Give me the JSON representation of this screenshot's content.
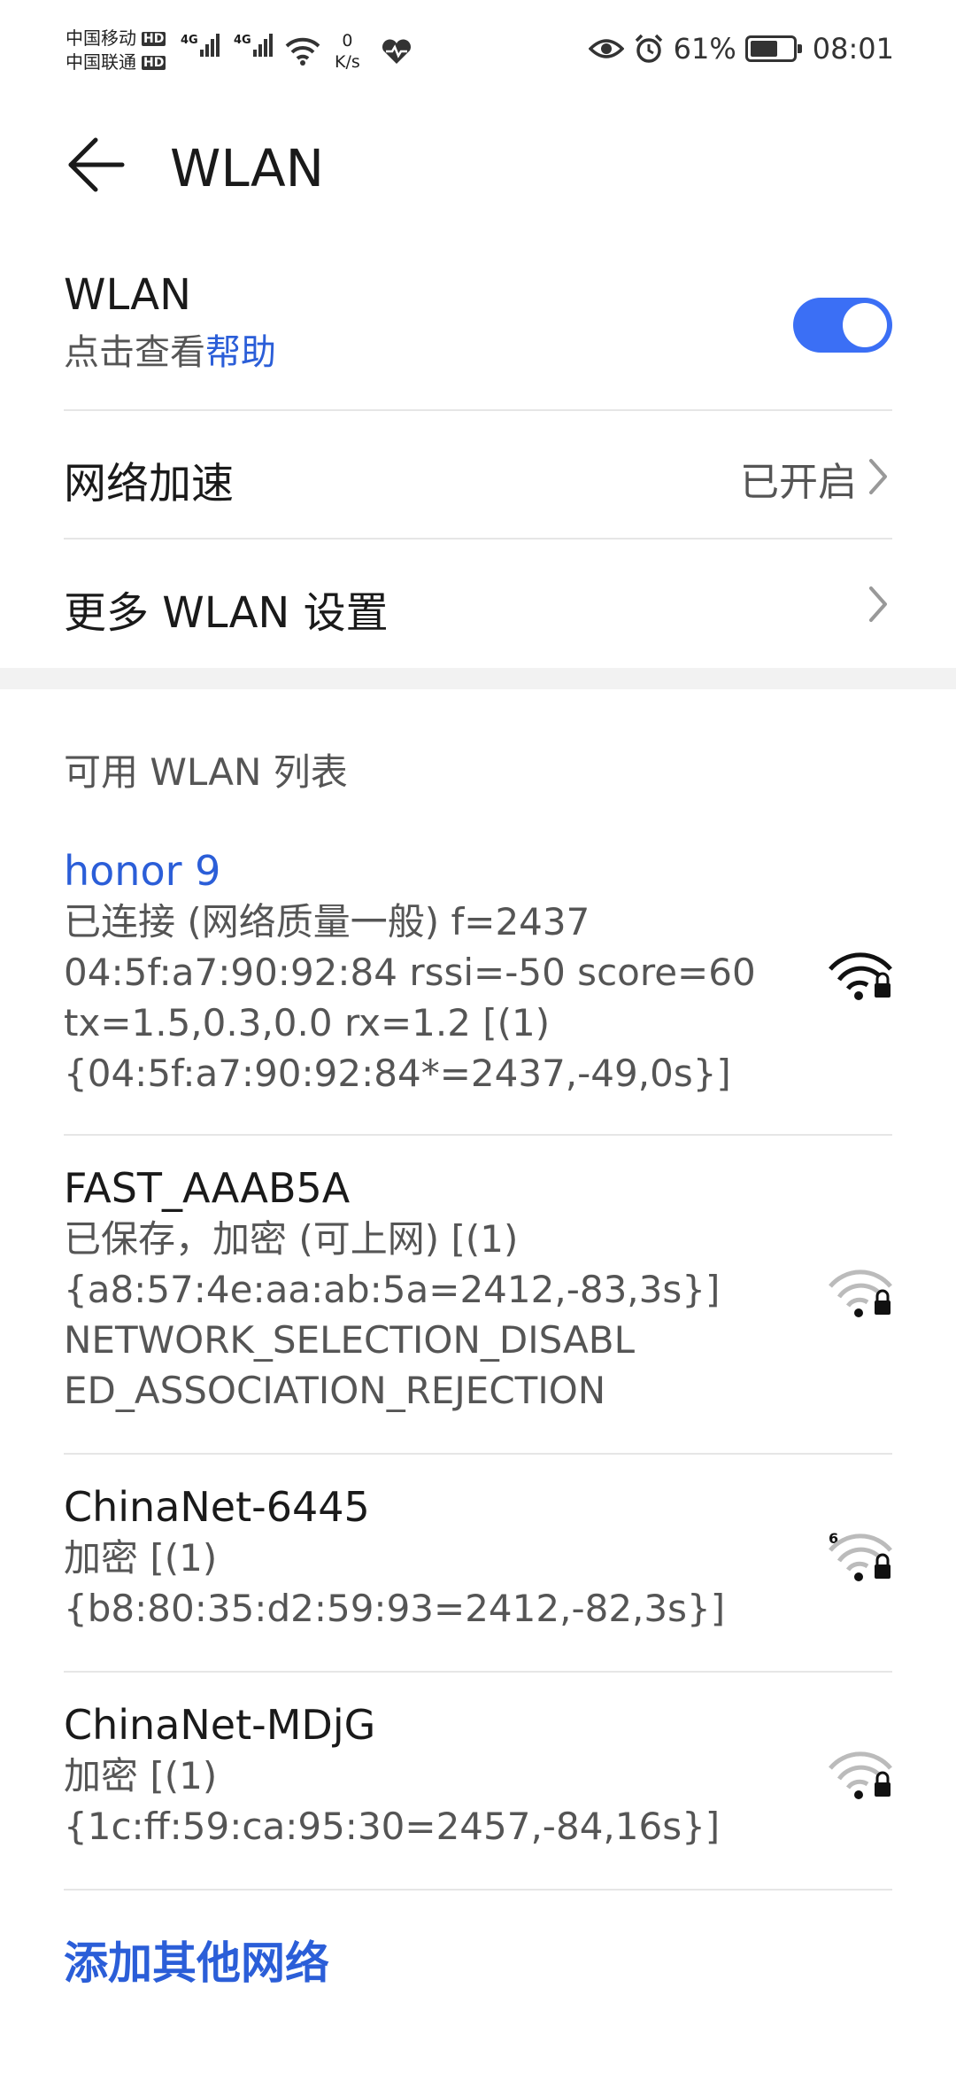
{
  "status_bar": {
    "carrier1": "中国移动",
    "carrier2": "中国联通",
    "hd": "HD",
    "net_type": "4G",
    "speed_value": "0",
    "speed_unit": "K/s",
    "battery": "61%",
    "time": "08:01"
  },
  "header": {
    "title": "WLAN"
  },
  "wlan_toggle": {
    "label": "WLAN",
    "hint_prefix": "点击查看",
    "hint_link": "帮助",
    "enabled": true
  },
  "network_accel": {
    "label": "网络加速",
    "value": "已开启"
  },
  "more_settings": {
    "label": "更多 WLAN 设置"
  },
  "list_title": "可用 WLAN 列表",
  "networks": [
    {
      "name": "honor 9",
      "line1": "已连接 (网络质量一般) f=2437",
      "line2": "04:5f:a7:90:92:84 rssi=-50  score=60",
      "line3": "tx=1.5,0.3,0.0 rx=1.2 [(1)",
      "line4": "{04:5f:a7:90:92:84*=2437,-49,0s}]",
      "icon": "wifi-lock-full-icon"
    },
    {
      "name": "FAST_AAAB5A",
      "line1": "已保存，加密 (可上网)  [(1)",
      "line2": "{a8:57:4e:aa:ab:5a=2412,-83,3s}]",
      "line3": "NETWORK_SELECTION_DISABL",
      "line4": "ED_ASSOCIATION_REJECTION",
      "icon": "wifi-lock-weak-icon"
    },
    {
      "name": "ChinaNet-6445",
      "line1": "加密  [(1)",
      "line2": "{b8:80:35:d2:59:93=2412,-82,3s}]",
      "badge": "6",
      "icon": "wifi6-lock-weak-icon"
    },
    {
      "name": "ChinaNet-MDjG",
      "line1": "加密  [(1)",
      "line2": "{1c:ff:59:ca:95:30=2457,-84,16s}]",
      "icon": "wifi-lock-weak-icon"
    }
  ],
  "add_network": "添加其他网络",
  "colors": {
    "accent": "#2b5ed8",
    "toggle_on": "#3b6ff5"
  }
}
